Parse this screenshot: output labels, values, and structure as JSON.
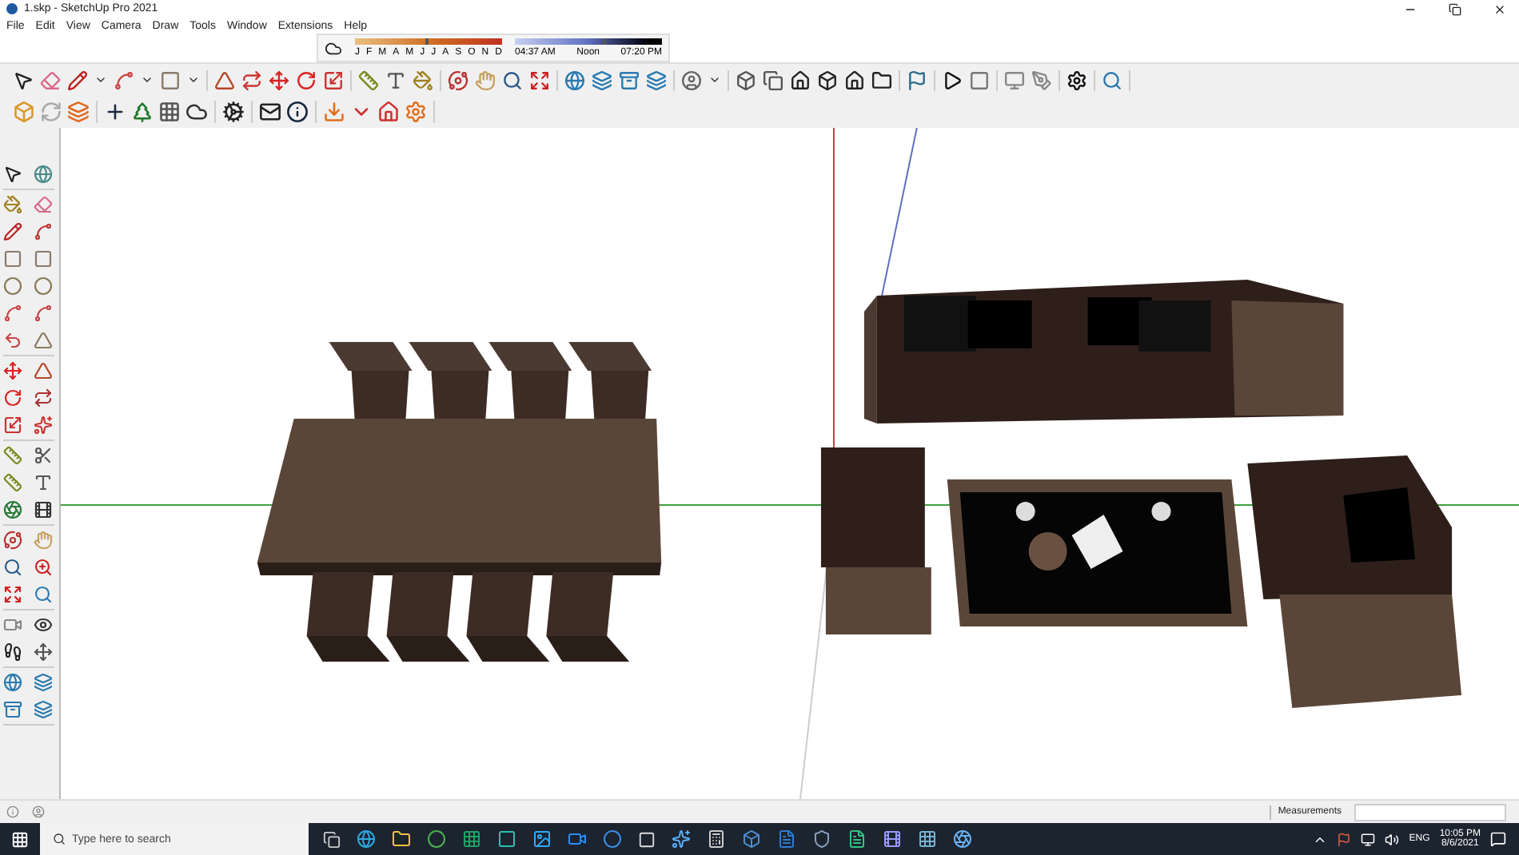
{
  "window": {
    "title": "1.skp - SketchUp Pro 2021"
  },
  "menu": [
    "File",
    "Edit",
    "View",
    "Camera",
    "Draw",
    "Tools",
    "Window",
    "Extensions",
    "Help"
  ],
  "shadow_settings": {
    "date_slider": {
      "level": 0.48,
      "labels": [
        "J",
        "F",
        "M",
        "A",
        "M",
        "J",
        "J",
        "A",
        "S",
        "O",
        "N",
        "D"
      ]
    },
    "time_slider": {
      "level": 0.6,
      "labels": [
        "04:37 AM",
        "Noon",
        "07:20 PM"
      ]
    }
  },
  "status_bar": {
    "measurements_label": "Measurements"
  },
  "taskbar": {
    "search": {
      "placeholder": "Type here to search"
    },
    "language": "ENG",
    "time": "10:05 PM",
    "date": "8/6/2021"
  }
}
